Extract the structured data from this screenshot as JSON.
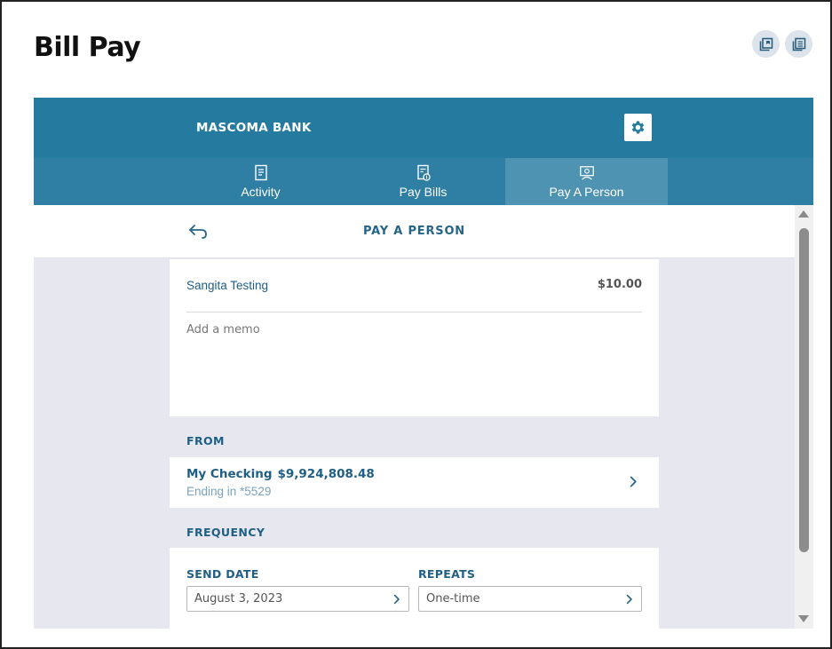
{
  "page": {
    "title": "Bill Pay"
  },
  "header": {
    "bank_name": "MASCOMA BANK",
    "accent_color": "#257aa0",
    "icons": [
      "pin-window-icon",
      "document-list-icon",
      "gear-icon"
    ]
  },
  "nav": {
    "tabs": [
      {
        "label": "Activity",
        "icon": "receipt-icon",
        "active": false
      },
      {
        "label": "Pay Bills",
        "icon": "bill-dollar-icon",
        "active": false
      },
      {
        "label": "Pay A Person",
        "icon": "person-money-icon",
        "active": true
      }
    ]
  },
  "subheader": {
    "title": "PAY A PERSON",
    "back_icon": "back-arrow-icon"
  },
  "payment": {
    "payee": "Sangita Testing",
    "amount": "$10.00",
    "memo_placeholder": "Add a memo"
  },
  "from": {
    "label": "FROM",
    "account_name": "My Checking",
    "balance": "$9,924,808.48",
    "ending": "Ending in *5529"
  },
  "frequency": {
    "label": "FREQUENCY",
    "send_date_label": "SEND DATE",
    "send_date_value": "August 3, 2023",
    "repeats_label": "REPEATS",
    "repeats_value": "One-time"
  }
}
